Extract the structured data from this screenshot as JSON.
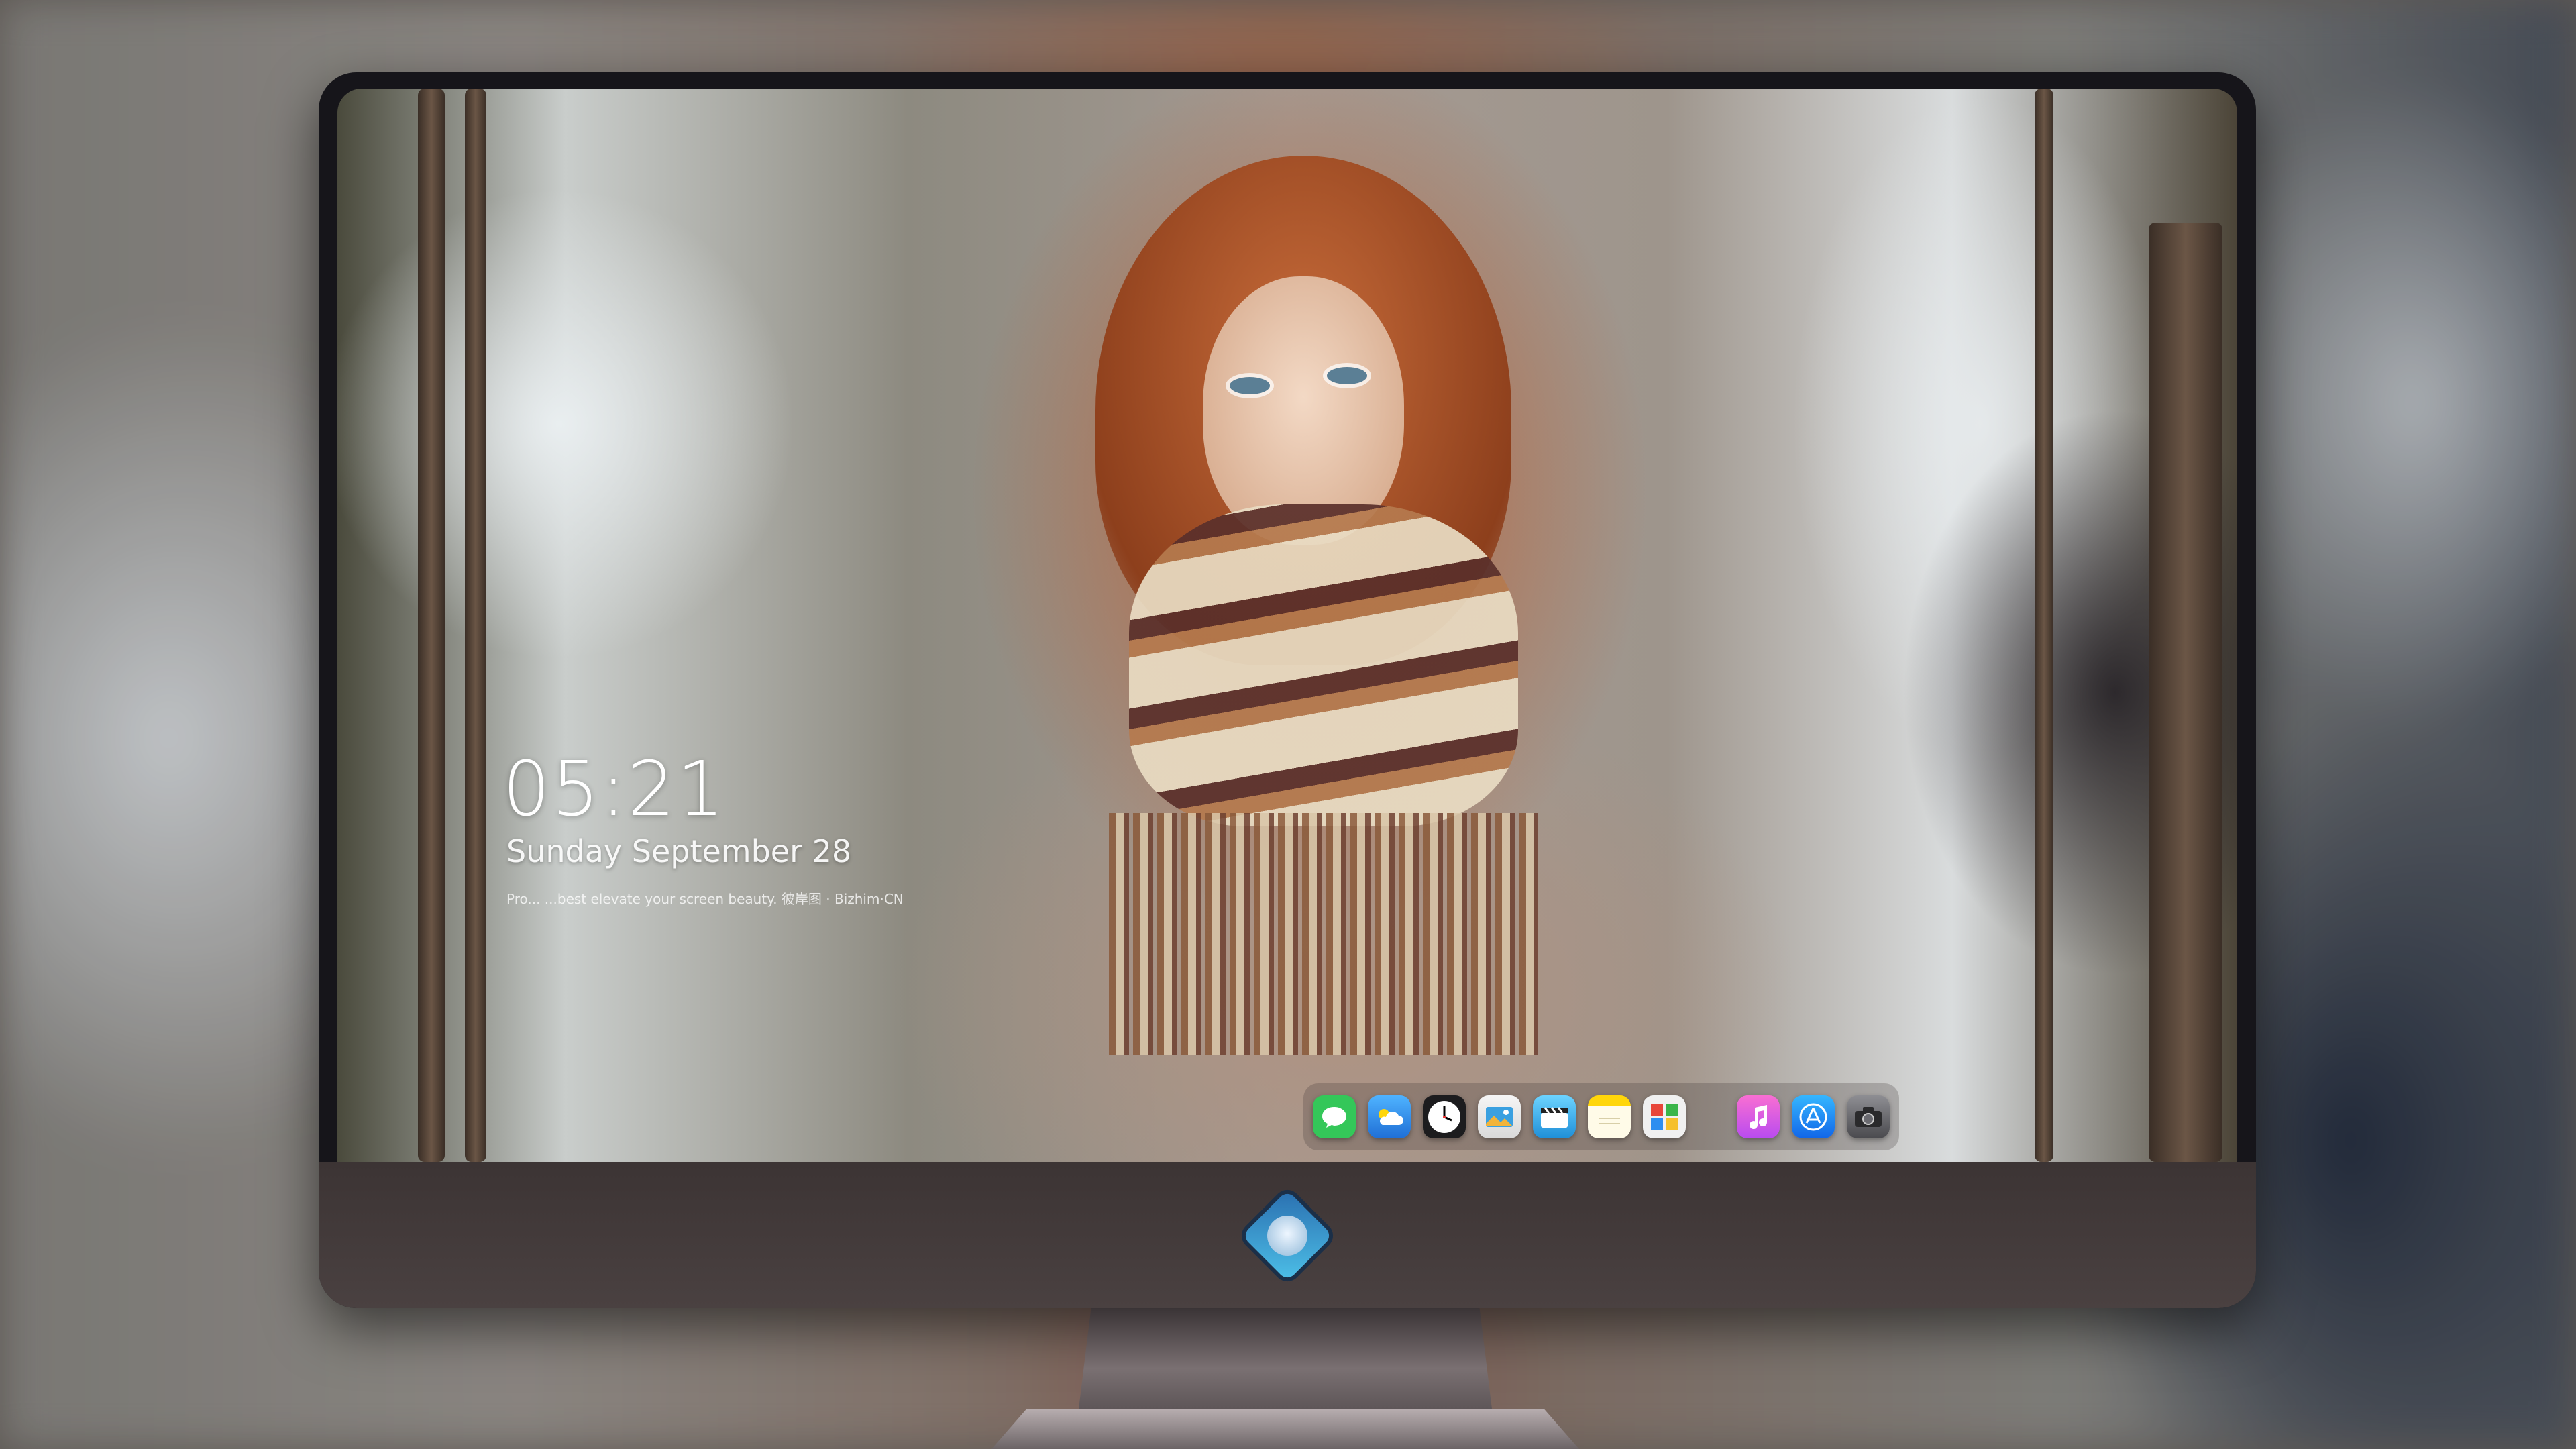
{
  "lockscreen": {
    "time": "05:21",
    "date": "Sunday September 28",
    "tagline": "Pro... ...best elevate your screen beauty. 彼岸图 · Bizhim·CN"
  },
  "dock": {
    "items": [
      {
        "name": "messages",
        "icon": "chat-bubble-icon",
        "color": "#34c759"
      },
      {
        "name": "weather",
        "icon": "cloud-icon",
        "color": "#2f8ee6"
      },
      {
        "name": "clock",
        "icon": "clock-icon",
        "color": "#1c1c1e"
      },
      {
        "name": "preview",
        "icon": "photo-viewer-icon",
        "color": "#e8a33a"
      },
      {
        "name": "clips",
        "icon": "clapperboard-icon",
        "color": "#3aa9e8"
      },
      {
        "name": "notes",
        "icon": "notepad-icon",
        "color": "#ffd60a"
      },
      {
        "name": "photo-booth",
        "icon": "gallery-icon",
        "color": "#c9473a"
      },
      {
        "name": "music",
        "icon": "music-note-icon",
        "color": "#f25cbf"
      },
      {
        "name": "app-store",
        "icon": "app-store-icon",
        "color": "#1a8cff"
      },
      {
        "name": "camera",
        "icon": "camera-icon",
        "color": "#6a6a6e"
      }
    ]
  },
  "monitor": {
    "logo_icon": "dragon-mascot-logo-icon"
  }
}
